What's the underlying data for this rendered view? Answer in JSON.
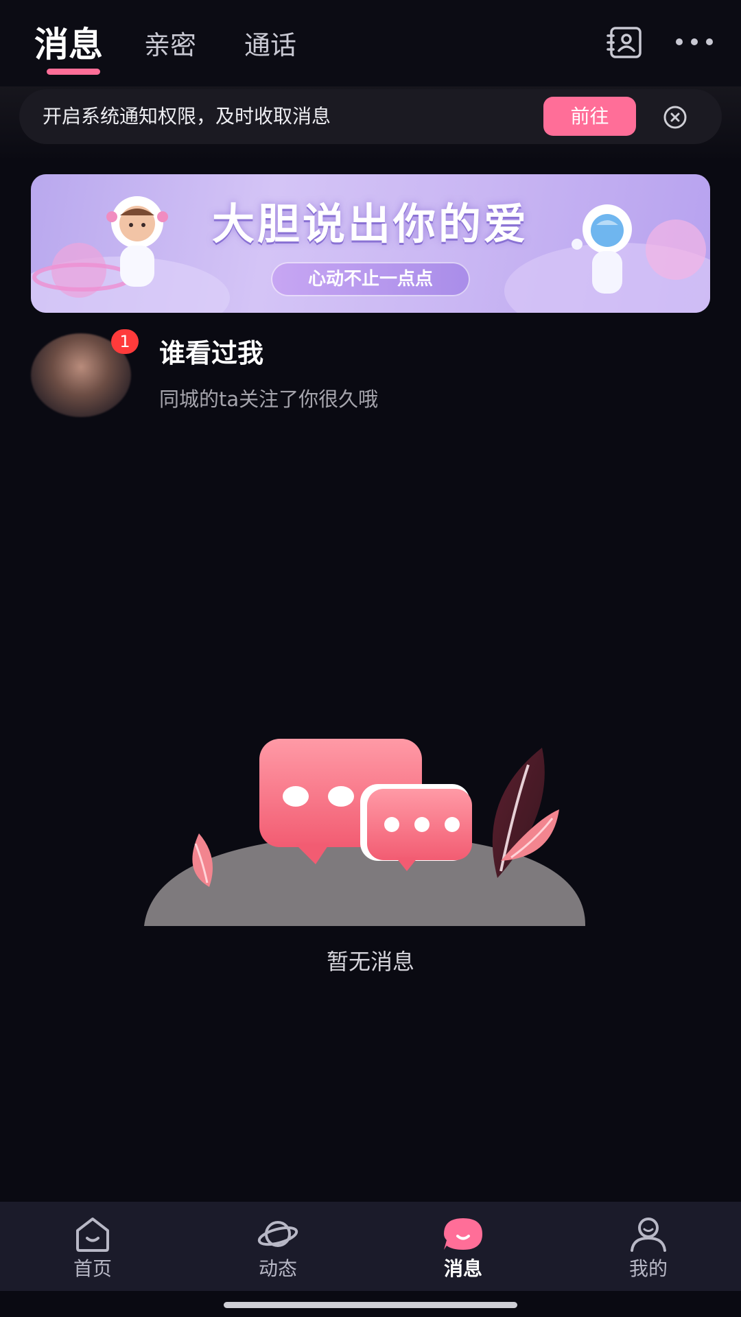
{
  "header": {
    "tabs": [
      {
        "label": "消息",
        "active": true
      },
      {
        "label": "亲密",
        "active": false
      },
      {
        "label": "通话",
        "active": false
      }
    ],
    "icons": [
      "contacts-icon",
      "more-icon"
    ],
    "accent_color": "#ff6e98"
  },
  "notification": {
    "text": "开启系统通知权限，及时收取消息",
    "button_label": "前往",
    "close_icon": "close-circle-icon"
  },
  "promo_banner": {
    "title": "大胆说出你的爱",
    "subtitle": "心动不止一点点"
  },
  "viewer_entry": {
    "title": "谁看过我",
    "subtitle": "同城的ta关注了你很久哦",
    "badge_count": "1"
  },
  "empty_state": {
    "text": "暂无消息",
    "icon": "chat-bubbles-illustration"
  },
  "bottom_nav": {
    "items": [
      {
        "label": "首页",
        "icon": "home-icon",
        "active": false
      },
      {
        "label": "动态",
        "icon": "planet-icon",
        "active": false
      },
      {
        "label": "消息",
        "icon": "message-bubble-icon",
        "active": true
      },
      {
        "label": "我的",
        "icon": "person-icon",
        "active": false
      }
    ]
  }
}
